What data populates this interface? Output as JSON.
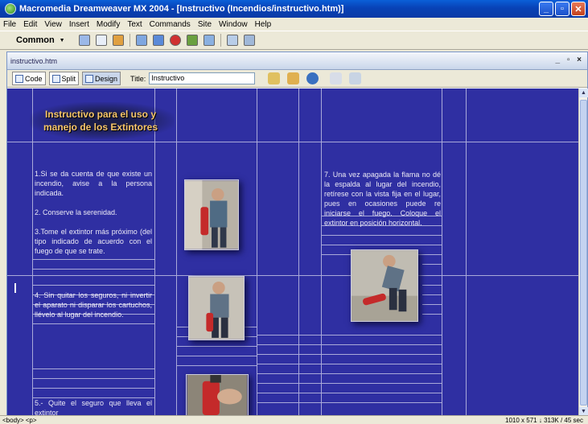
{
  "window": {
    "title": "Macromedia Dreamweaver MX 2004 - [Instructivo (Incendios/instructivo.htm)]",
    "minimize": "_",
    "maximize": "▫",
    "close": "✕"
  },
  "menu": [
    "File",
    "Edit",
    "View",
    "Insert",
    "Modify",
    "Text",
    "Commands",
    "Site",
    "Window",
    "Help"
  ],
  "insert_bar": {
    "category": "Common",
    "arrow": "▼"
  },
  "document": {
    "tab": "instructivo.htm",
    "window_controls": "_ ▫ ×",
    "views": {
      "code": "Code",
      "split": "Split",
      "design": "Design"
    },
    "title_label": "Title:",
    "title_value": "Instructivo"
  },
  "page": {
    "heading": "Instructivo para el uso y manejo de los Extintores",
    "step1": "1.Si se da cuenta de que existe un incendio, avise a la persona indicada.",
    "step2": "2. Conserve la serenidad.",
    "step3": "3.Tome el extintor más próximo (del tipo indicado de acuerdo con el fuego de que se trate.",
    "step4": "4. Sin quitar los seguros, ni invertir el aparato ni disparar los cartuchos, llévelo al lugar del incendio.",
    "step5": "5.- Quite el seguro que lleva el extintor",
    "step7": "7. Una vez apagada la flama no dé la espalda al lugar del incendio, retírese con la vista fija en el lugar, pues en ocasiones puede re iniciarse el fuego. Coloque el extintor en posición horizontal."
  },
  "status": {
    "tags": [
      "<body>",
      "<p>"
    ],
    "info": "1010 x 571 ↓ 313K / 45 sec"
  },
  "colors": {
    "canvas_bg": "#2f2fa2",
    "heading_text": "#f7c66a",
    "titlebar": "#0a5fd8"
  }
}
